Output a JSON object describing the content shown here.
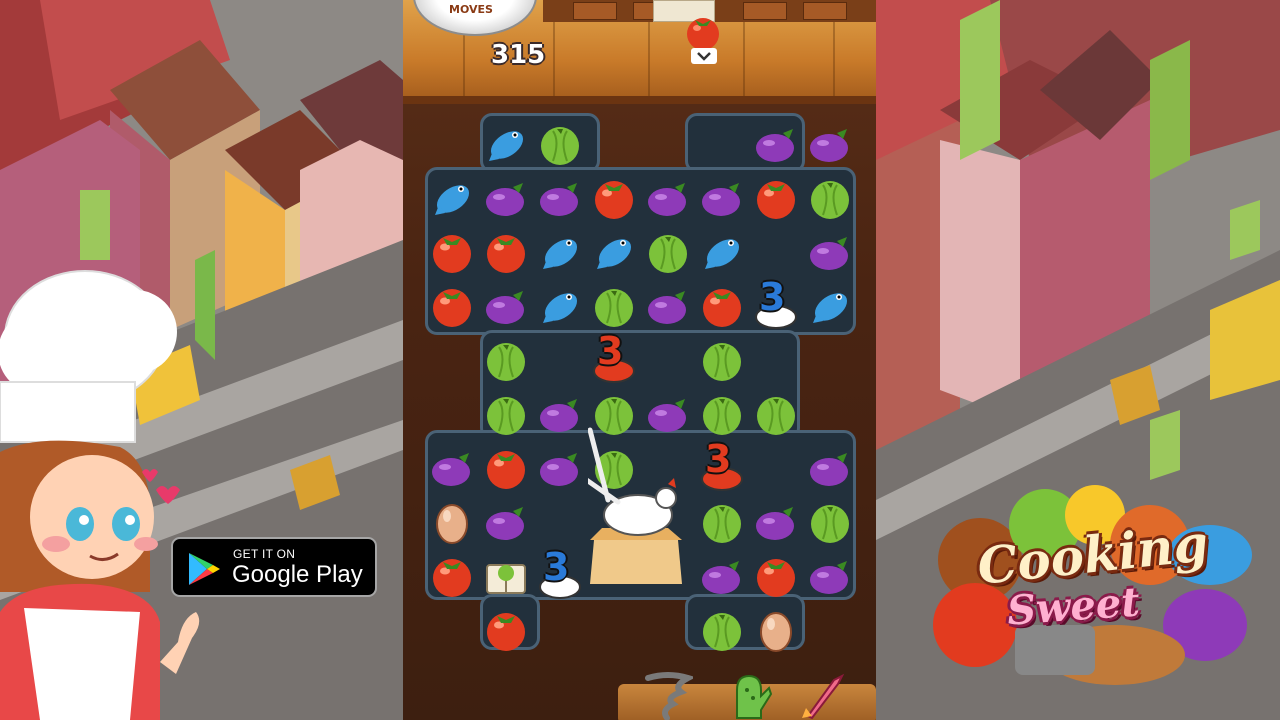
{
  "hud": {
    "moves_label": "MOVES",
    "moves_count": "315",
    "goal_icon": "tomato-icon"
  },
  "board": {
    "rows": [
      [
        "",
        "fish",
        "apple",
        "",
        "",
        "",
        "eggplant",
        "eggplant",
        ""
      ],
      [
        "fish",
        "eggplant",
        "eggplant",
        "tomato",
        "eggplant",
        "eggplant",
        "tomato",
        "apple",
        ""
      ],
      [
        "tomato",
        "tomato",
        "fish",
        "fish",
        "apple",
        "fish",
        "",
        "eggplant",
        ""
      ],
      [
        "tomato",
        "eggplant",
        "fish",
        "apple",
        "eggplant",
        "tomato",
        "egg-blocker-3",
        "fish",
        ""
      ],
      [
        "",
        "apple",
        "",
        "tomato-blocker-3",
        "",
        "apple",
        "",
        "",
        ""
      ],
      [
        "",
        "apple",
        "eggplant",
        "apple",
        "eggplant",
        "apple",
        "apple",
        "",
        ""
      ],
      [
        "eggplant",
        "tomato",
        "eggplant",
        "apple",
        "",
        "tomato-blocker-3",
        "",
        "eggplant",
        ""
      ],
      [
        "egg",
        "eggplant",
        "",
        "",
        "",
        "apple",
        "eggplant",
        "apple",
        ""
      ],
      [
        "tomato",
        "book",
        "egg-blocker-3",
        "",
        "",
        "eggplant",
        "tomato",
        "eggplant",
        ""
      ],
      [
        "",
        "tomato",
        "",
        "",
        "",
        "apple",
        "egg",
        "",
        ""
      ]
    ],
    "blocker_value": "3",
    "hen_nest": "hen-nest"
  },
  "boosters": [
    "tornado-booster-icon",
    "oven-mitt-booster-icon",
    "rocket-booster-icon"
  ],
  "menu_icon": "menu-icon",
  "badge": {
    "small_text": "GET IT ON",
    "big_text": "Google Play"
  },
  "logo": {
    "line1": "Cooking",
    "line2": "Sweet"
  },
  "colors": {
    "tomato": "#e23b1f",
    "apple": "#7cc23a",
    "eggplant": "#8e3ab8",
    "fish": "#3a9de0",
    "board_bg": "#22303c",
    "board_border": "#4a6276"
  }
}
